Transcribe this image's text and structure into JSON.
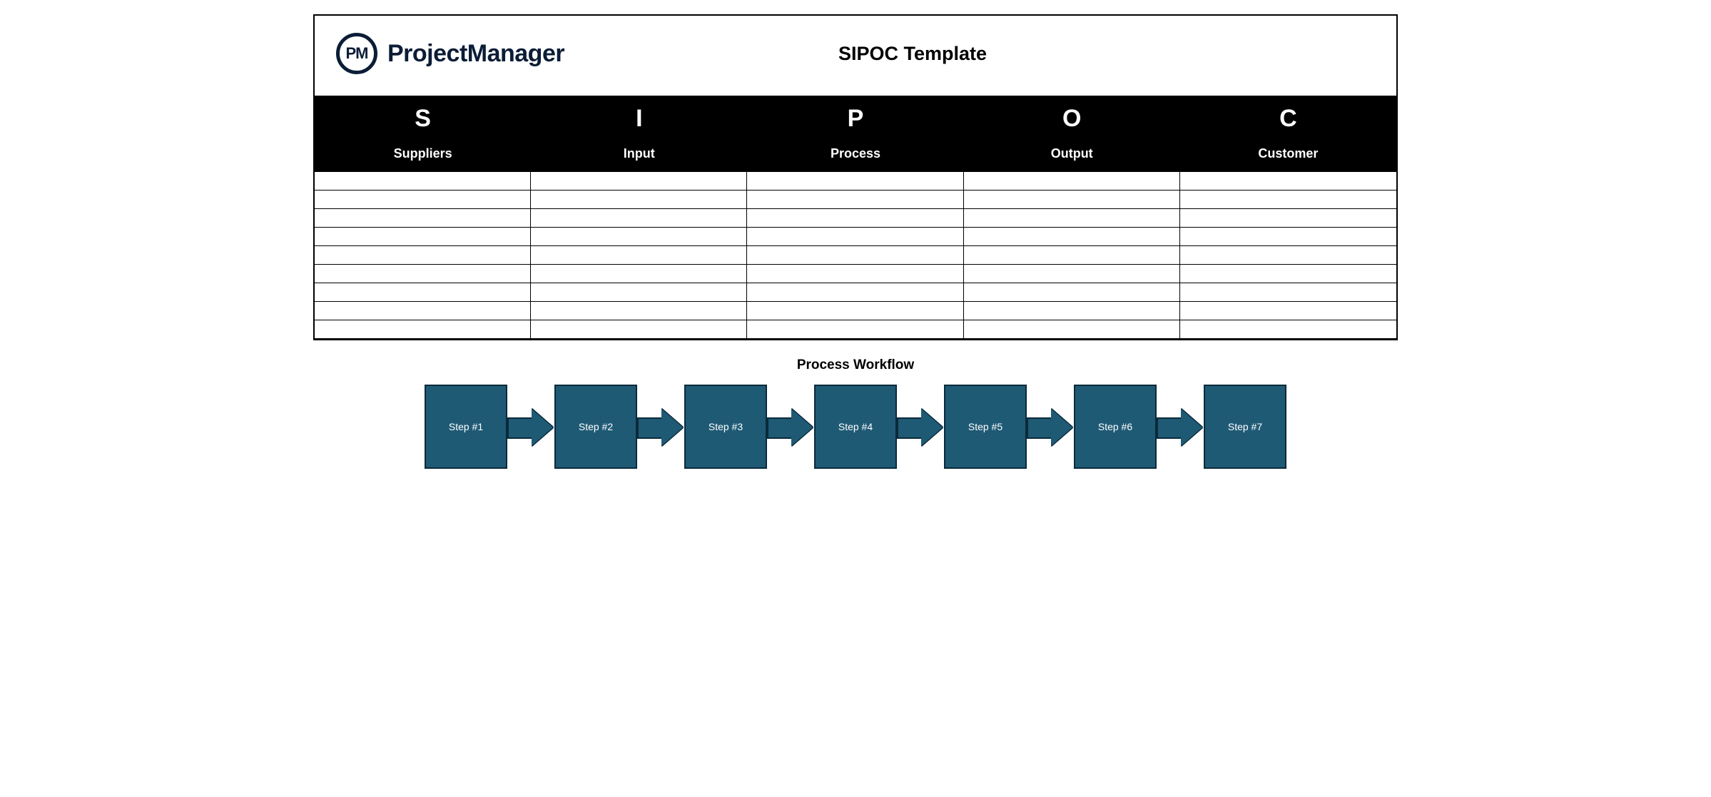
{
  "brand": {
    "logo_text": "PM",
    "name": "ProjectManager"
  },
  "title": "SIPOC Template",
  "columns": [
    {
      "letter": "S",
      "label": "Suppliers"
    },
    {
      "letter": "I",
      "label": "Input"
    },
    {
      "letter": "P",
      "label": "Process"
    },
    {
      "letter": "O",
      "label": "Output"
    },
    {
      "letter": "C",
      "label": "Customer"
    }
  ],
  "rows": [
    {
      "suppliers": "",
      "input": "",
      "process": "",
      "output": "",
      "customer": ""
    },
    {
      "suppliers": "",
      "input": "",
      "process": "",
      "output": "",
      "customer": ""
    },
    {
      "suppliers": "",
      "input": "",
      "process": "",
      "output": "",
      "customer": ""
    },
    {
      "suppliers": "",
      "input": "",
      "process": "",
      "output": "",
      "customer": ""
    },
    {
      "suppliers": "",
      "input": "",
      "process": "",
      "output": "",
      "customer": ""
    },
    {
      "suppliers": "",
      "input": "",
      "process": "",
      "output": "",
      "customer": ""
    },
    {
      "suppliers": "",
      "input": "",
      "process": "",
      "output": "",
      "customer": ""
    },
    {
      "suppliers": "",
      "input": "",
      "process": "",
      "output": "",
      "customer": ""
    },
    {
      "suppliers": "",
      "input": "",
      "process": "",
      "output": "",
      "customer": ""
    }
  ],
  "workflow": {
    "title": "Process Workflow",
    "steps": [
      "Step #1",
      "Step #2",
      "Step #3",
      "Step #4",
      "Step #5",
      "Step #6",
      "Step #7"
    ]
  }
}
